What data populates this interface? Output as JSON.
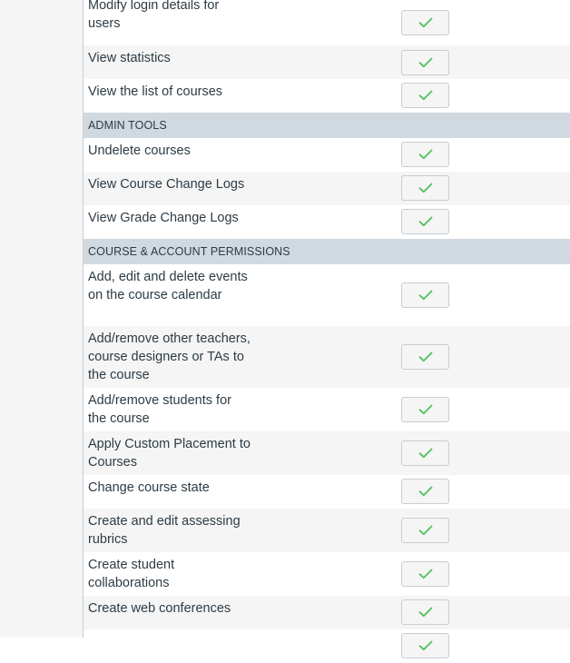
{
  "permissions": {
    "rows": [
      {
        "label": "Modify login details for users",
        "lines": 2
      },
      {
        "label": "View statistics",
        "lines": 1
      },
      {
        "label": "View the list of courses",
        "lines": 1
      },
      {
        "label": "ADMIN TOOLS",
        "header": true
      },
      {
        "label": "Undelete courses",
        "lines": 1
      },
      {
        "label": "View Course Change Logs",
        "lines": 1
      },
      {
        "label": "View Grade Change Logs",
        "lines": 1
      },
      {
        "label": "COURSE & ACCOUNT PERMISSIONS",
        "header": true
      },
      {
        "label": "Add, edit and delete events on the course calendar",
        "lines": 3
      },
      {
        "label": "Add/remove other teachers, course designers or TAs to the course",
        "lines": 3
      },
      {
        "label": "Add/remove students for the course",
        "lines": 2
      },
      {
        "label": "Apply Custom Placement to Courses",
        "lines": 2
      },
      {
        "label": "Change course state",
        "lines": 1
      },
      {
        "label": "Create and edit assessing rubrics",
        "lines": 2
      },
      {
        "label": "Create student collaborations",
        "lines": 2
      },
      {
        "label": "Create web conferences",
        "lines": 1
      },
      {
        "label": "",
        "lines": 1
      }
    ],
    "check_icon": "checkmark-icon",
    "check_color": "#4fc15b"
  }
}
